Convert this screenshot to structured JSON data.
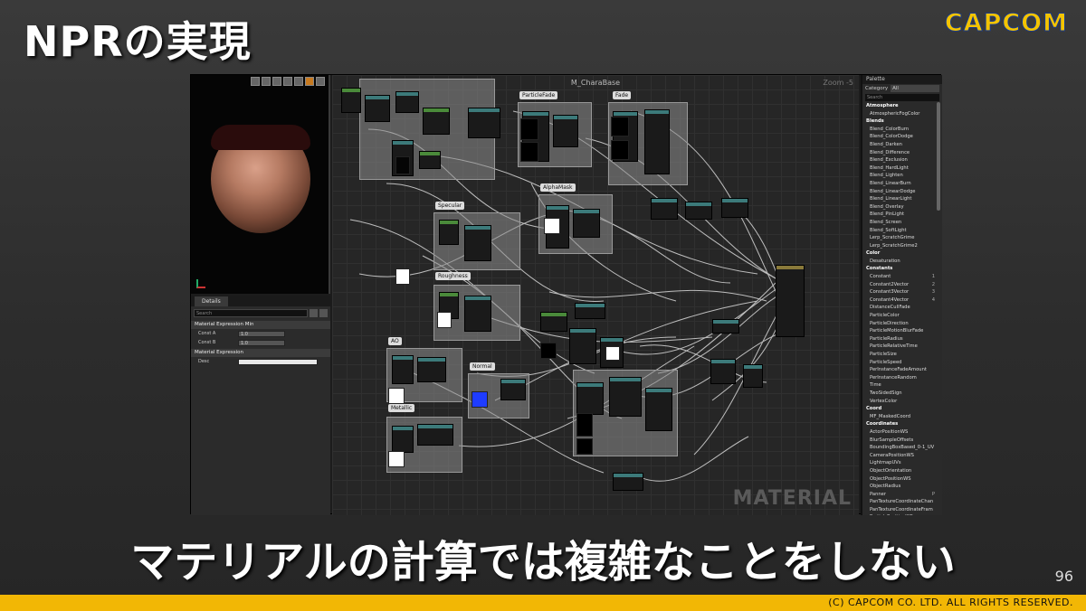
{
  "slide": {
    "title": "NPRの実現",
    "logo": "CAPCOM",
    "caption": "マテリアルの計算では複雑なことをしない",
    "page_number": "96",
    "copyright": "(C) CAPCOM CO. LTD. ALL RIGHTS RESERVED."
  },
  "details": {
    "tab_label": "Details",
    "search_placeholder": "Search",
    "section1": "Material Expression Min",
    "props": [
      {
        "label": "Const A",
        "value": "1.0"
      },
      {
        "label": "Const B",
        "value": "1.0"
      }
    ],
    "section2": "Material Expression",
    "desc_label": "Desc"
  },
  "graph": {
    "title": "M_CharaBase",
    "zoom": "Zoom -5",
    "watermark": "MATERIAL",
    "comments": [
      "ParticleFade",
      "Fade",
      "AlphaMask",
      "Specular",
      "Roughness",
      "AO",
      "Normal",
      "Metallic"
    ]
  },
  "palette": {
    "tab_label": "Palette",
    "category_label": "Category",
    "category_value": "All",
    "search_placeholder": "Search",
    "items": [
      {
        "text": "Atmosphere",
        "header": true,
        "key": ""
      },
      {
        "text": "AtmosphericFogColor",
        "header": false,
        "key": ""
      },
      {
        "text": "Blends",
        "header": true,
        "key": ""
      },
      {
        "text": "Blend_ColorBurn",
        "header": false,
        "key": ""
      },
      {
        "text": "Blend_ColorDodge",
        "header": false,
        "key": ""
      },
      {
        "text": "Blend_Darken",
        "header": false,
        "key": ""
      },
      {
        "text": "Blend_Difference",
        "header": false,
        "key": ""
      },
      {
        "text": "Blend_Exclusion",
        "header": false,
        "key": ""
      },
      {
        "text": "Blend_HardLight",
        "header": false,
        "key": ""
      },
      {
        "text": "Blend_Lighten",
        "header": false,
        "key": ""
      },
      {
        "text": "Blend_LinearBurn",
        "header": false,
        "key": ""
      },
      {
        "text": "Blend_LinearDodge",
        "header": false,
        "key": ""
      },
      {
        "text": "Blend_LinearLight",
        "header": false,
        "key": ""
      },
      {
        "text": "Blend_Overlay",
        "header": false,
        "key": ""
      },
      {
        "text": "Blend_PinLight",
        "header": false,
        "key": ""
      },
      {
        "text": "Blend_Screen",
        "header": false,
        "key": ""
      },
      {
        "text": "Blend_SoftLight",
        "header": false,
        "key": ""
      },
      {
        "text": "Lerp_ScratchGrime",
        "header": false,
        "key": ""
      },
      {
        "text": "Lerp_ScratchGrime2",
        "header": false,
        "key": ""
      },
      {
        "text": "Color",
        "header": true,
        "key": ""
      },
      {
        "text": "Desaturation",
        "header": false,
        "key": ""
      },
      {
        "text": "Constants",
        "header": true,
        "key": ""
      },
      {
        "text": "Constant",
        "header": false,
        "key": "1"
      },
      {
        "text": "Constant2Vector",
        "header": false,
        "key": "2"
      },
      {
        "text": "Constant3Vector",
        "header": false,
        "key": "3"
      },
      {
        "text": "Constant4Vector",
        "header": false,
        "key": "4"
      },
      {
        "text": "DistanceCullFade",
        "header": false,
        "key": ""
      },
      {
        "text": "ParticleColor",
        "header": false,
        "key": ""
      },
      {
        "text": "ParticleDirection",
        "header": false,
        "key": ""
      },
      {
        "text": "ParticleMotionBlurFade",
        "header": false,
        "key": ""
      },
      {
        "text": "ParticleRadius",
        "header": false,
        "key": ""
      },
      {
        "text": "ParticleRelativeTime",
        "header": false,
        "key": ""
      },
      {
        "text": "ParticleSize",
        "header": false,
        "key": ""
      },
      {
        "text": "ParticleSpeed",
        "header": false,
        "key": ""
      },
      {
        "text": "PerInstanceFadeAmount",
        "header": false,
        "key": ""
      },
      {
        "text": "PerInstanceRandom",
        "header": false,
        "key": ""
      },
      {
        "text": "Time",
        "header": false,
        "key": ""
      },
      {
        "text": "TwoSidedSign",
        "header": false,
        "key": ""
      },
      {
        "text": "VertexColor",
        "header": false,
        "key": ""
      },
      {
        "text": "Coord",
        "header": true,
        "key": ""
      },
      {
        "text": "MF_MaskedCoord",
        "header": false,
        "key": ""
      },
      {
        "text": "Coordinates",
        "header": true,
        "key": ""
      },
      {
        "text": "ActorPositionWS",
        "header": false,
        "key": ""
      },
      {
        "text": "BlurSampleOffsets",
        "header": false,
        "key": ""
      },
      {
        "text": "BoundingBoxBased_0-1_UV",
        "header": false,
        "key": ""
      },
      {
        "text": "CameraPositionWS",
        "header": false,
        "key": ""
      },
      {
        "text": "LightmapUVs",
        "header": false,
        "key": ""
      },
      {
        "text": "ObjectOrientation",
        "header": false,
        "key": ""
      },
      {
        "text": "ObjectPositionWS",
        "header": false,
        "key": ""
      },
      {
        "text": "ObjectRadius",
        "header": false,
        "key": ""
      },
      {
        "text": "Panner",
        "header": false,
        "key": "P"
      },
      {
        "text": "PanTextureCoordinateChan",
        "header": false,
        "key": ""
      },
      {
        "text": "PanTextureCoordinateFram",
        "header": false,
        "key": ""
      },
      {
        "text": "ParticlePositionWS",
        "header": false,
        "key": ""
      }
    ]
  },
  "colors": {
    "footer": "#f2b705",
    "logo": "#f4c400",
    "normal_swatch": "#1e3cff"
  }
}
